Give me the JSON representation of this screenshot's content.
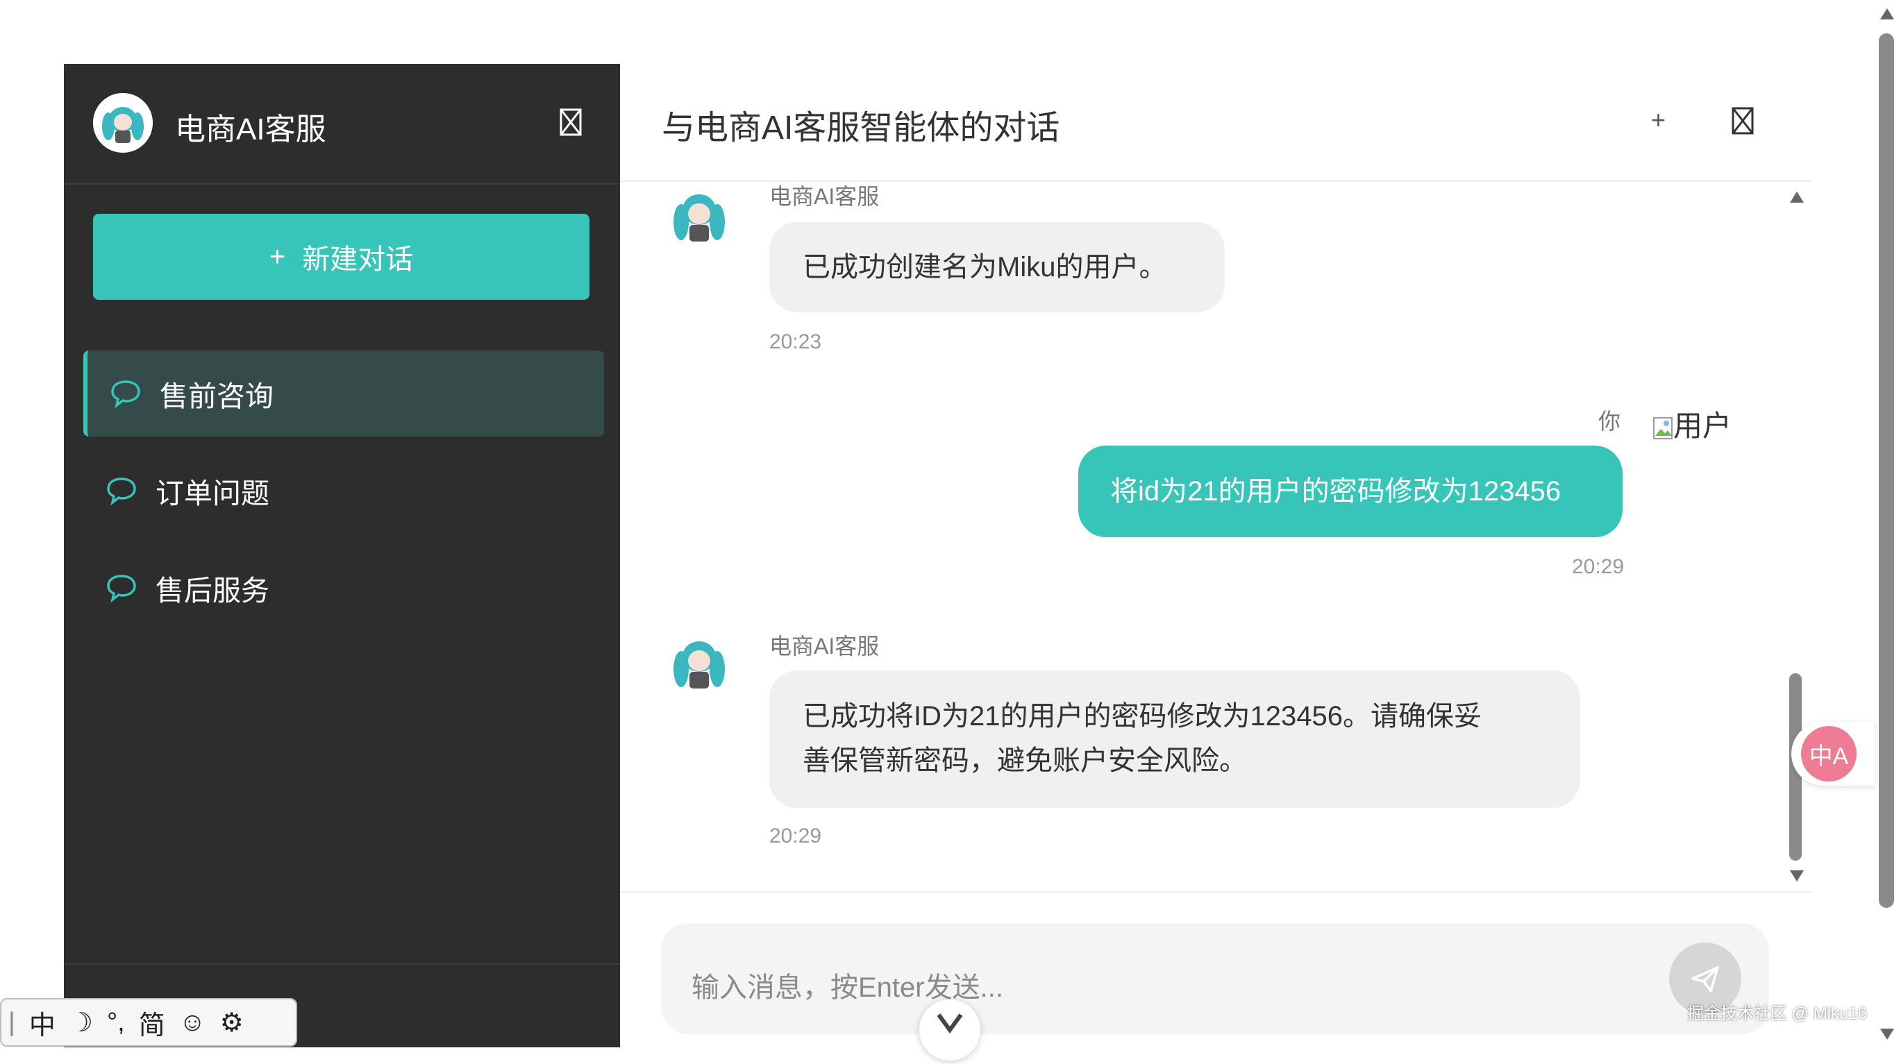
{
  "sidebar": {
    "title": "电商AI客服",
    "new_chat_label": "新建对话",
    "new_chat_icon": "+",
    "conversations": [
      {
        "label": "售前咨询",
        "active": true
      },
      {
        "label": "订单问题",
        "active": false
      },
      {
        "label": "售后服务",
        "active": false
      }
    ]
  },
  "header": {
    "title": "与电商AI客服智能体的对话",
    "plus_icon": "+"
  },
  "messages": [
    {
      "role": "ai",
      "sender": "电商AI客服",
      "text": "已成功创建名为Miku的用户。",
      "time": "20:23"
    },
    {
      "role": "user",
      "sender": "你",
      "avatar_alt": "用户",
      "text": "将id为21的用户的密码修改为123456",
      "time": "20:29"
    },
    {
      "role": "ai",
      "sender": "电商AI客服",
      "text_line1": "已成功将ID为21的用户的密码修改为123456。请确保妥",
      "text_line2": "善保管新密码，避免账户安全风险。",
      "time": "20:29"
    }
  ],
  "input": {
    "placeholder": "输入消息，按Enter发送..."
  },
  "ime": {
    "items": [
      "中",
      "☽",
      "°,",
      "简",
      "☺",
      "⚙"
    ]
  },
  "translate": {
    "label": "中A"
  },
  "watermark": "掘金技术社区 @ Miku16",
  "colors": {
    "accent": "#36c5b8",
    "sidebar_bg": "#2d2d2d",
    "active_item_bg": "#344b49"
  }
}
